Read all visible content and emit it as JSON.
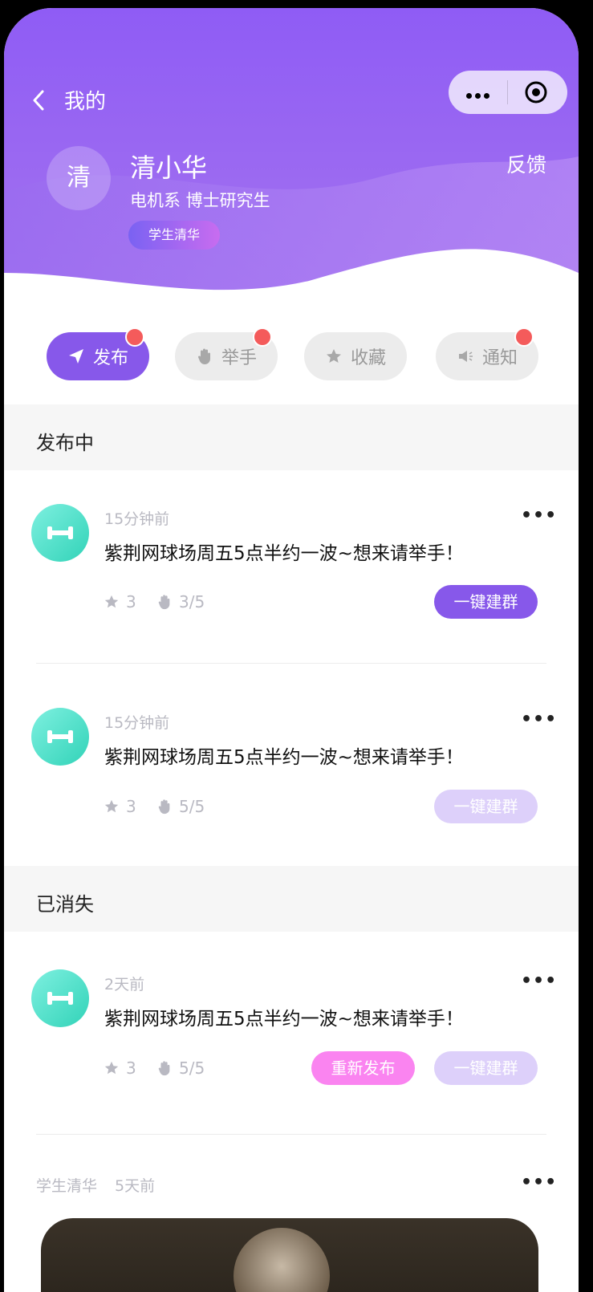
{
  "nav": {
    "title": "我的"
  },
  "profile": {
    "avatar_char": "清",
    "name": "清小华",
    "dept": "电机系 博士研究生",
    "tag": "学生清华",
    "feedback": "反馈"
  },
  "tabs": [
    {
      "label": "发布",
      "icon": "send-icon",
      "active": true,
      "badge": true
    },
    {
      "label": "举手",
      "icon": "hand-icon",
      "active": false,
      "badge": true
    },
    {
      "label": "收藏",
      "icon": "star-icon",
      "active": false,
      "badge": false
    },
    {
      "label": "通知",
      "icon": "speaker-icon",
      "active": false,
      "badge": true
    }
  ],
  "sections": {
    "publishing": "发布中",
    "vanished": "已消失"
  },
  "posts": [
    {
      "time": "15分钟前",
      "text": "紫荆网球场周五5点半约一波~想来请举手！",
      "stars": "3",
      "hands": "3/5",
      "group_btn": "一键建群",
      "more": "•••"
    },
    {
      "time": "15分钟前",
      "text": "紫荆网球场周五5点半约一波~想来请举手！",
      "stars": "3",
      "hands": "5/5",
      "group_btn": "一键建群",
      "more": "•••"
    },
    {
      "time": "2天前",
      "text": "紫荆网球场周五5点半约一波~想来请举手！",
      "stars": "3",
      "hands": "5/5",
      "repost_btn": "重新发布",
      "group_btn": "一键建群",
      "more": "•••"
    }
  ],
  "footer_post": {
    "author": "学生清华",
    "time": "5天前",
    "more": "•••"
  },
  "colors": {
    "primary": "#8758ea",
    "disabled": "#ddd0fa",
    "pink": "#fa84f0",
    "badge": "#f45b5b",
    "teal": "#32d3b8"
  }
}
